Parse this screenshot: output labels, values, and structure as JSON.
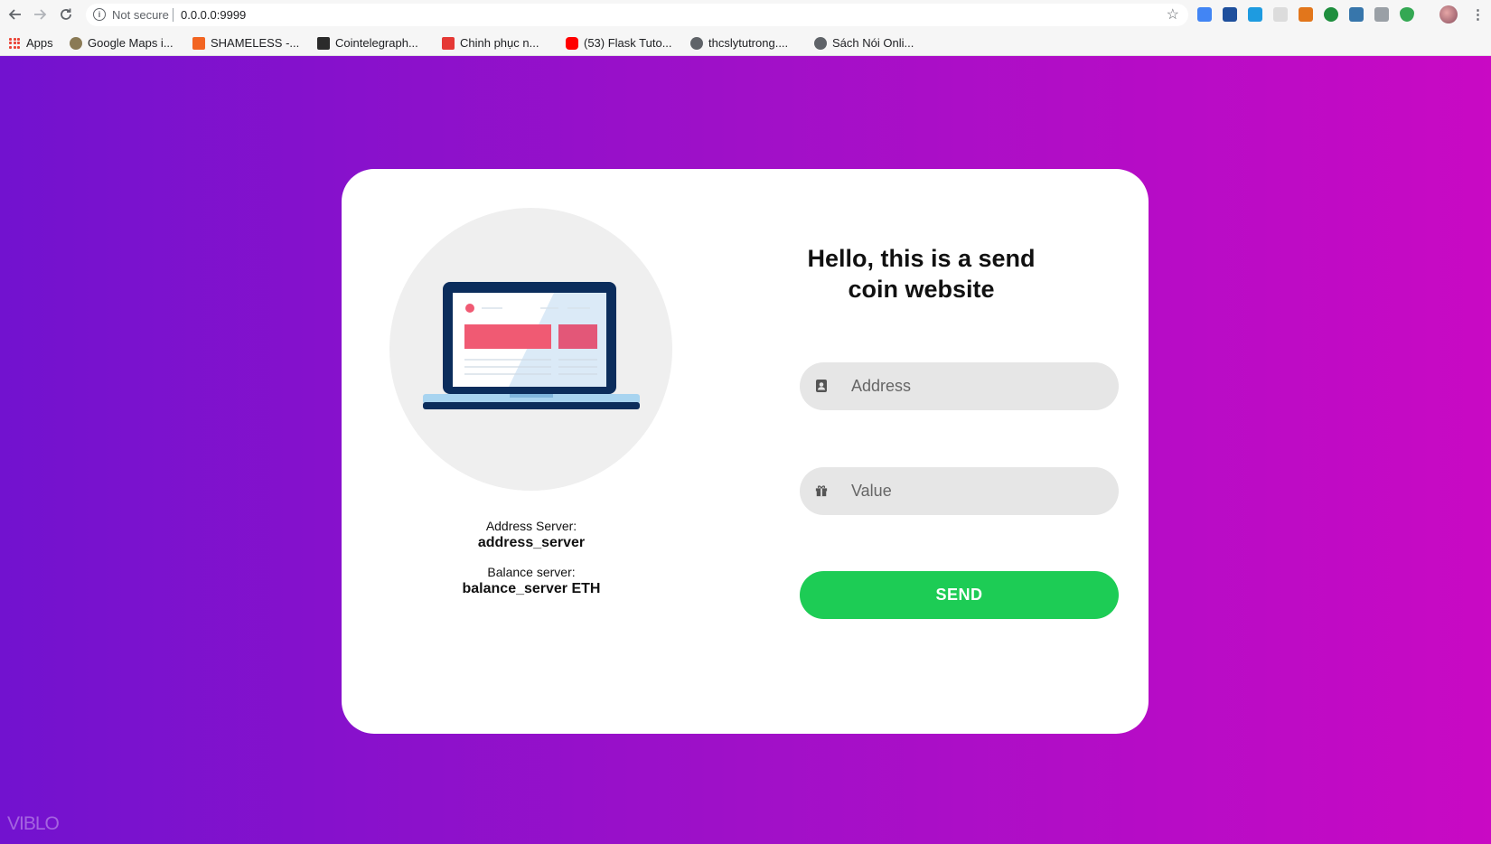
{
  "browser": {
    "security_label": "Not secure",
    "url": "0.0.0.0:9999",
    "bookmarks": [
      {
        "label": "Apps"
      },
      {
        "label": "Google Maps i..."
      },
      {
        "label": "SHAMELESS -..."
      },
      {
        "label": "Cointelegraph..."
      },
      {
        "label": "Chinh phục n..."
      },
      {
        "label": "(53) Flask Tuto..."
      },
      {
        "label": "thcslytutrong...."
      },
      {
        "label": "Sách Nói Onli..."
      }
    ]
  },
  "page": {
    "title": "Hello, this is a send coin website",
    "address_server_label": "Address Server:",
    "address_server_value": "address_server",
    "balance_server_label": "Balance server:",
    "balance_server_value": "balance_server ETH",
    "address_placeholder": "Address",
    "value_placeholder": "Value",
    "send_label": "SEND",
    "watermark": "VIBLO"
  },
  "colors": {
    "gradient_start": "#7212cf",
    "gradient_end": "#c909c4",
    "send_button": "#1dcc55",
    "field_bg": "#e6e6e6"
  }
}
